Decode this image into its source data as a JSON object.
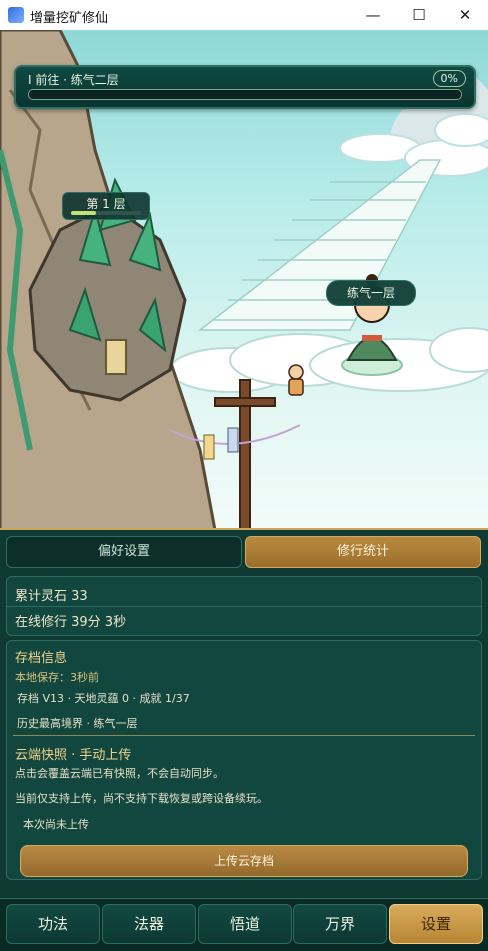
{
  "window": {
    "title": "增量挖矿修仙",
    "minimize_glyph": "—",
    "maximize_glyph": "☐",
    "close_glyph": "✕"
  },
  "progress": {
    "label": "I 前往 · 练气二层",
    "percent_text": "0%",
    "fraction": 0.0
  },
  "scene": {
    "layer_label": "第 1 层",
    "layer_fraction": 0.35,
    "realm_label": "练气一层"
  },
  "panel": {
    "tabs": [
      {
        "label": "偏好设置",
        "active": false
      },
      {
        "label": "修行统计",
        "active": true
      }
    ],
    "stats": {
      "stones": "累计灵石  33",
      "online": "在线修行  39分 3秒"
    },
    "save": {
      "title": "存档信息",
      "local_saved": "本地保存：3秒前",
      "meta": "存档 V13 · 天地灵蕴 0 · 成就 1/37",
      "highest": "历史最高境界 · 练气一层",
      "cloud_title": "云端快照 · 手动上传",
      "cloud_desc1": "点击会覆盖云端已有快照，不会自动同步。",
      "cloud_desc2": "当前仅支持上传，尚不支持下载恢复或跨设备续玩。",
      "cloud_status": "本次尚未上传",
      "upload_button": "上传云存档"
    }
  },
  "nav": [
    {
      "label": "功法"
    },
    {
      "label": "法器"
    },
    {
      "label": "悟道"
    },
    {
      "label": "万界"
    },
    {
      "label": "设置",
      "active": true
    }
  ],
  "colors": {
    "accent": "#c8a35a",
    "panel": "#0f3a34",
    "sky": "#b9ecea"
  }
}
